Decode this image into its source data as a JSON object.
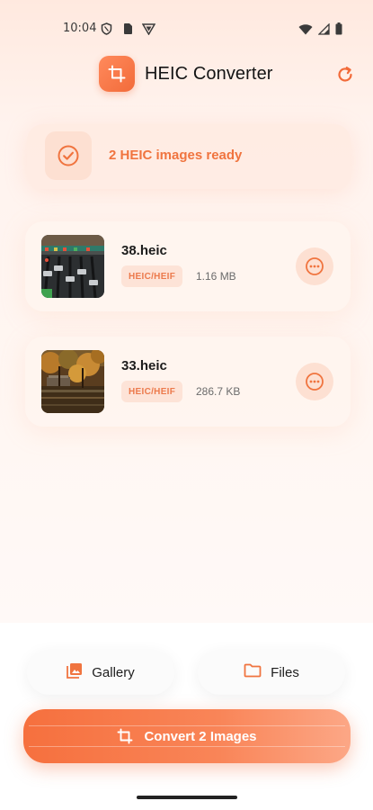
{
  "status_bar": {
    "time": "10:04",
    "left_icons": [
      "shield-icon",
      "sim-card-icon",
      "vpn-icon"
    ],
    "right_icons": [
      "wifi-icon",
      "signal-icon",
      "battery-icon"
    ]
  },
  "header": {
    "logo_icon": "crop-icon",
    "title": "HEIC Converter",
    "refresh_icon": "refresh-icon"
  },
  "banner": {
    "icon": "check-circle-icon",
    "text": "2 HEIC images ready"
  },
  "files": [
    {
      "name": "38.heic",
      "format": "HEIC/HEIF",
      "size": "1.16 MB",
      "thumbnail": "mixing-console-photo"
    },
    {
      "name": "33.heic",
      "format": "HEIC/HEIF",
      "size": "286.7 KB",
      "thumbnail": "autumn-trees-photo"
    }
  ],
  "actions": {
    "gallery_label": "Gallery",
    "files_label": "Files",
    "convert_label": "Convert 2 Images"
  },
  "colors": {
    "accent": "#f26b3a",
    "accent_light": "#fde0d2",
    "badge_text": "#ec7a4c"
  }
}
